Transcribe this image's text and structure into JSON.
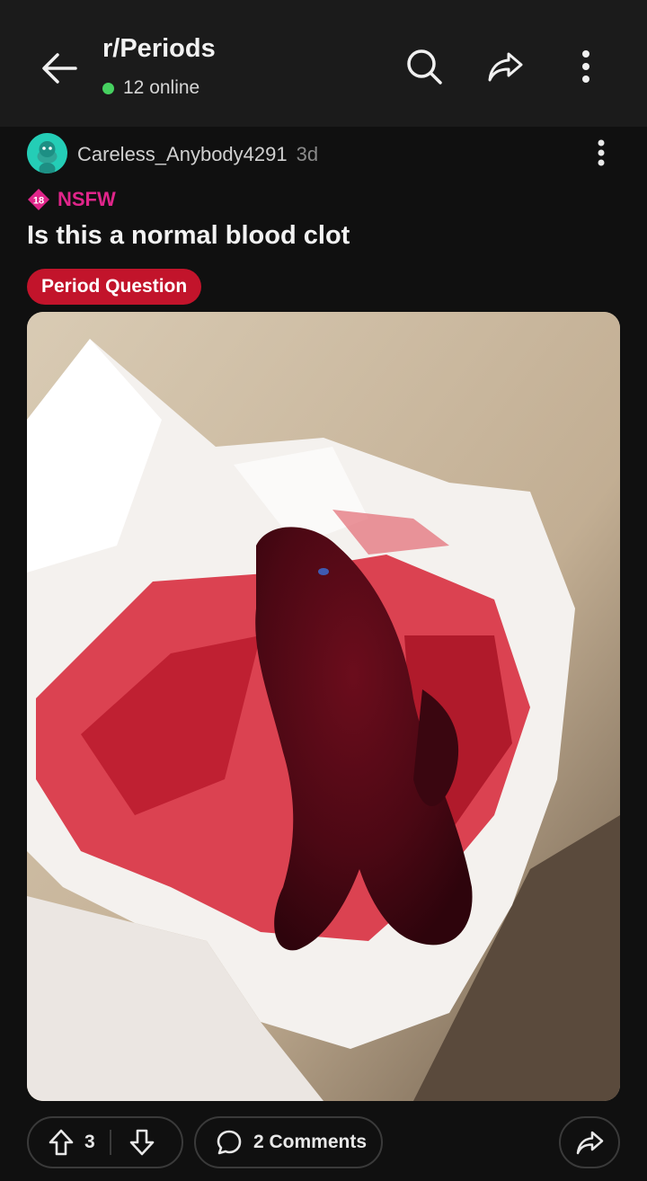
{
  "header": {
    "subreddit": "r/Periods",
    "online": "12 online"
  },
  "post": {
    "author": "Careless_Anybody4291",
    "age": "3d",
    "nsfw_label": "NSFW",
    "nsfw_badge": "18",
    "title": "Is this a normal blood clot",
    "flair": "Period Question",
    "image_alt": "Photo of a dark red blood clot on white tissue paper"
  },
  "actions": {
    "score": "3",
    "comments": "2 Comments"
  },
  "colors": {
    "flair": "#c2142b",
    "nsfw": "#e0258a",
    "online_dot": "#46d160",
    "avatar": "#24cdb6"
  },
  "icons": [
    "back-arrow-icon",
    "search-icon",
    "share-icon",
    "more-vertical-icon",
    "upvote-icon",
    "downvote-icon",
    "comment-icon"
  ]
}
